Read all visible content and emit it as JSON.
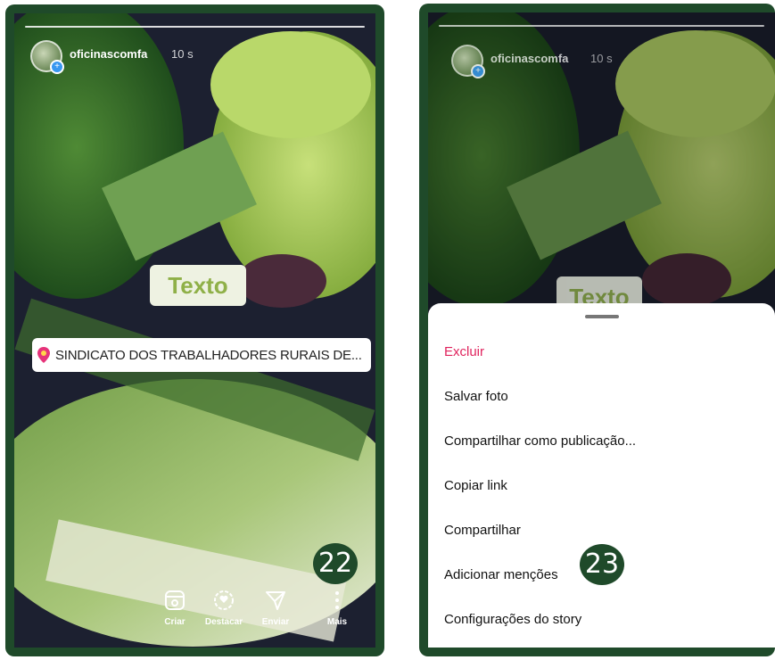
{
  "left_screen": {
    "username": "oficinascomfa",
    "time": "10 s",
    "text_sticker": "Texto",
    "location_sticker": "SINDICATO DOS TRABALHADORES RURAIS DE...",
    "actions": [
      {
        "label": "Criar",
        "icon": "create-icon"
      },
      {
        "label": "Destacar",
        "icon": "highlight-icon"
      },
      {
        "label": "Enviar",
        "icon": "send-icon"
      },
      {
        "label": "Mais",
        "icon": "more-icon"
      }
    ],
    "badge": "22"
  },
  "right_screen": {
    "username": "oficinascomfa",
    "time": "10 s",
    "text_sticker": "Texto",
    "menu": [
      {
        "label": "Excluir",
        "danger": true
      },
      {
        "label": "Salvar foto"
      },
      {
        "label": "Compartilhar como publicação..."
      },
      {
        "label": "Copiar link"
      },
      {
        "label": "Compartilhar"
      },
      {
        "label": "Adicionar menções"
      },
      {
        "label": "Configurações do story"
      }
    ],
    "badge": "23"
  },
  "colors": {
    "frame": "#1f4a2a",
    "danger": "#e0245e",
    "sticker_text": "#8fb048",
    "pin": "#e6337a"
  }
}
